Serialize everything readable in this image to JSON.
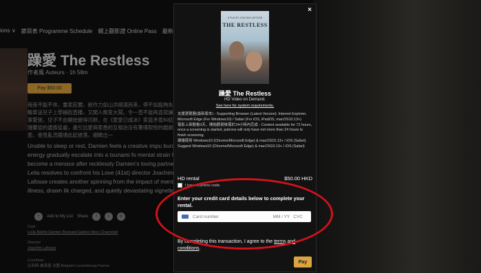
{
  "nav": {
    "items": [
      "ions ∨",
      "節目表 Programme Schedule",
      "網上觀影證 Online Pass",
      "最新"
    ]
  },
  "film": {
    "title": "躁愛 The Restless",
    "meta": "作者風 Auteurs · 1h 58m",
    "pay_label": "Pay $50.00",
    "synopsis_zh": "夜夜不能不休，畫家莊爾，創作力如山洪傾瀉而來，停不如能夠失控，驅車送兒子上學稱街直播，又闖入鄰室大鬧。令一直不能再造就讓情事事緊張，兒子不由開始變得沉默，在《愛愛已成冰》家庭矛盾糾結，但隨饗從的遺族從處，盡引出愛與家悉的互相治沒有驚嘆取悅的戲劇場面，使見亂流鐘通此起彼落，細緻出一",
    "synopsis_en": "Unable to sleep or rest, Damien feels a creative impu bursts of energy gradually escalate into a tsunami fo mental strain has become a menace after recklessly Damien's loving partner Leila resolves to confront his Love (41st) director Joachim Lafosse creates another spinning from the impact of mental illness, drawn lik charged, and quietly devastating vignettes.",
    "add_to_list": "Add to My List",
    "share_label": "Share",
    "cast_label": "Cast",
    "cast_value": "Leïla Bekhti Damien Bonnard Gabriel Merz Chammah",
    "director_label": "Director",
    "director_value": "Joachim Lafosse",
    "countries_label": "Countries",
    "countries_value": "比利時 盧森堡 法國 Belgium Luxembourg France"
  },
  "modal": {
    "close_label": "×",
    "poster_title": "THE RESTLESS",
    "poster_sub": "A FILM BY JOACHIM LAFOSSE",
    "title": "躁愛 The Restless",
    "subtitle": "HD Video on Demand.",
    "requirements_link": "See here for system requirements.",
    "info_lines": [
      "支援瀏覽器(最新版本) - Supporting Browser (Latest Version): Internet Explorer, Microsoft Edge (For Windows10) / Safari (For iOS, iPadOS, macOS10.13+)",
      "電影上架觀看3天，開始觀賞後需於24小時內完成 - Content available for 72 hours, once a screening is started, patrons will only have not more than 24 hours to finish screening.",
      "建議使用 Windows10 (Chrome/Microsoft Edge) & macOS10.13+ / iOS (Safari)",
      "Suggest Windows10 (Chrome/Microsoft Edge) & macOS10.13+ / iOS (Safari)"
    ],
    "rental_label": "HD rental",
    "rental_price": "$50.00 HKD",
    "promo_label": "I have a promo code.",
    "cc_heading": "Enter your credit card details below to complete your rental.",
    "card_placeholder": "Card number",
    "exp_placeholder": "MM / YY",
    "cvc_placeholder": "CVC",
    "terms_prefix": "By completing this transaction, I agree to the ",
    "terms_link": "terms and conditions",
    "terms_suffix": ".",
    "pay_label": "Pay"
  },
  "colors": {
    "accent": "#d9a441",
    "annotation": "#d1121a",
    "modal_bg": "#121212"
  }
}
